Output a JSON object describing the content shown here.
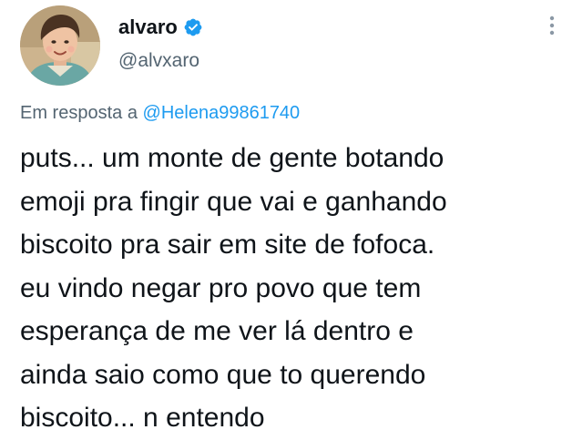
{
  "author": {
    "display_name": "alvaro",
    "handle": "@alvxaro",
    "verified": true,
    "verified_icon": "verified-badge-icon",
    "avatar": "profile-photo-child"
  },
  "menu": {
    "icon": "more-vertical-icon"
  },
  "reply": {
    "prefix": "Em resposta a",
    "mention": "@Helena99861740"
  },
  "tweet": {
    "text": "puts... um monte de gente botando\nemoji pra fingir que vai e ganhando\nbiscoito pra sair em site de fofoca.\neu vindo negar pro povo que tem\nesperança de me ver lá dentro e\nainda saio como que to querendo\nbiscoito... n entendo"
  },
  "colors": {
    "text": "#0f1419",
    "secondary": "#536471",
    "accent": "#1d9bf0"
  }
}
